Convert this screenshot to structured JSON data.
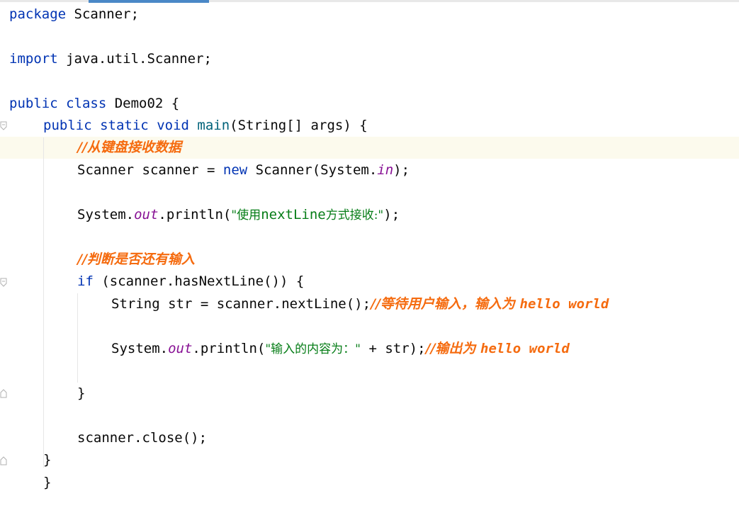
{
  "editor": {
    "line_package": {
      "kw": "package",
      "text": " Scanner;"
    },
    "line_import": {
      "kw": "import",
      "text": " java.util.Scanner;"
    },
    "line_class": {
      "kw1": "public",
      "kw2": "class",
      "text": " Demo02 {"
    },
    "line_main": {
      "kw1": "public",
      "kw2": "static",
      "kw3": "void",
      "method": "main",
      "text": "(String[] args) {"
    },
    "comment_keyboard": "//从键盘接收数据",
    "line_scanner": {
      "text1": "Scanner scanner = ",
      "kw": "new",
      "text2": " Scanner(System.",
      "field": "in",
      "text3": ");"
    },
    "line_print1": {
      "text1": "System.",
      "field": "out",
      "text2": ".println(",
      "str_open": "\"使用",
      "str_mid": "nextLine",
      "str_close": "方式接收:\"",
      "text3": ");"
    },
    "comment_check": "//判断是否还有输入",
    "line_if": {
      "kw": "if",
      "text": " (scanner.hasNextLine()) {"
    },
    "line_str": {
      "text": "String str = scanner.nextLine();",
      "comment_cn": "//等待用户输入，输入为 ",
      "comment_en": "hello world"
    },
    "line_print2": {
      "text1": "System.",
      "field": "out",
      "text2": ".println(",
      "str": "\"输入的内容为：\"",
      "text3": " + str);",
      "comment_cn": "//输出为 ",
      "comment_en": "hello world"
    },
    "line_if_close": "}",
    "line_close": "scanner.close();",
    "line_main_close": "}",
    "line_class_close": "}"
  },
  "colors": {
    "keyword": "#0033b3",
    "string": "#067d17",
    "field": "#871094",
    "comment": "#f56b0f",
    "current_line": "#fcfaed",
    "accent": "#4a88c7"
  }
}
